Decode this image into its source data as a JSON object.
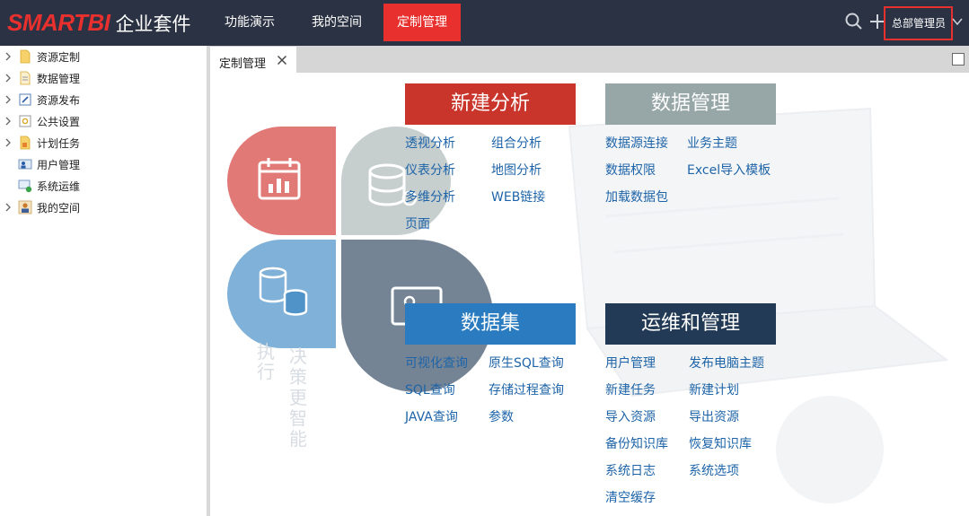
{
  "logo": {
    "brand": "SMARTBI",
    "suite": "企业套件"
  },
  "nav": {
    "items": [
      {
        "label": "功能演示"
      },
      {
        "label": "我的空间"
      },
      {
        "label": "定制管理"
      }
    ],
    "admin_label": "总部管理员",
    "brand_color": "#e8302e",
    "bar_color": "#2b3243"
  },
  "icons": {
    "search": "search-icon",
    "add": "plus-icon",
    "dropdown": "chevron-down-icon",
    "close": "close-icon",
    "maximize": "maximize-icon"
  },
  "sidebar": {
    "items": [
      {
        "label": "资源定制",
        "icon": "folder-icon"
      },
      {
        "label": "数据管理",
        "icon": "folder-list-icon"
      },
      {
        "label": "资源发布",
        "icon": "edit-doc-icon"
      },
      {
        "label": "公共设置",
        "icon": "settings-doc-icon"
      },
      {
        "label": "计划任务",
        "icon": "rss-doc-icon"
      },
      {
        "label": "用户管理",
        "icon": "users-icon"
      },
      {
        "label": "系统运维",
        "icon": "monitor-icon"
      },
      {
        "label": "我的空间",
        "icon": "person-icon"
      }
    ]
  },
  "tab": {
    "label": "定制管理"
  },
  "sections": {
    "analysis": {
      "title": "新建分析",
      "color": "#c9352b",
      "links": [
        "透视分析",
        "组合分析",
        "仪表分析",
        "地图分析",
        "多维分析",
        "WEB链接",
        "页面"
      ]
    },
    "data_mgmt": {
      "title": "数据管理",
      "color": "#97a6a6",
      "links": [
        "数据源连接",
        "业务主题",
        "数据权限",
        "Excel导入模板",
        "加载数据包"
      ]
    },
    "dataset": {
      "title": "数据集",
      "color": "#2a7bbf",
      "links": [
        "可视化查询",
        "原生SQL查询",
        "SQL查询",
        "存储过程查询",
        "JAVA查询",
        "参数"
      ]
    },
    "ops": {
      "title": "运维和管理",
      "color": "#223a55",
      "links": [
        "用户管理",
        "发布电脑主题",
        "新建任务",
        "新建计划",
        "导入资源",
        "导出资源",
        "备份知识库",
        "恢复知识库",
        "系统日志",
        "系统选项",
        "清空缓存"
      ]
    }
  },
  "background": {
    "watermark_a": "执行",
    "watermark_b": "决策更智能"
  }
}
